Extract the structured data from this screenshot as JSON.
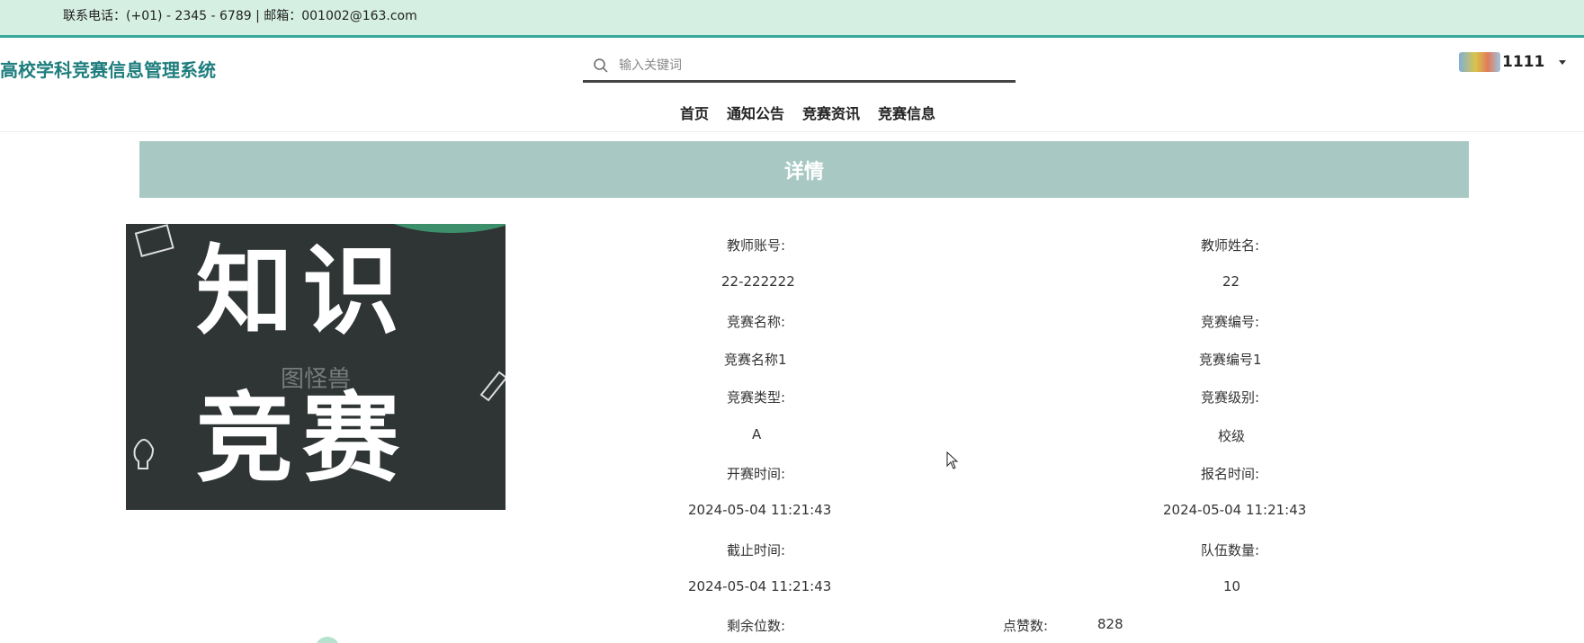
{
  "topbar": {
    "contact": "联系电话：(+01) - 2345 - 6789 | 邮箱：001002@163.com"
  },
  "header": {
    "site_title": "高校学科竞赛信息管理系统",
    "search_placeholder": "输入关键词",
    "user_name": "1111"
  },
  "nav": [
    "首页",
    "通知公告",
    "竞赛资讯",
    "竞赛信息"
  ],
  "banner": {
    "title": "详情"
  },
  "poster": {
    "line1": "知识",
    "line2": "竞赛",
    "watermark": "图怪兽"
  },
  "details": {
    "teacher_account_label": "教师账号:",
    "teacher_account": "22-222222",
    "teacher_name_label": "教师姓名:",
    "teacher_name": "22",
    "contest_name_label": "竞赛名称:",
    "contest_name": "竞赛名称1",
    "contest_no_label": "竞赛编号:",
    "contest_no": "竞赛编号1",
    "contest_type_label": "竞赛类型:",
    "contest_type": "A",
    "contest_level_label": "竞赛级别:",
    "contest_level": "校级",
    "start_time_label": "开赛时间:",
    "start_time": "2024-05-04 11:21:43",
    "signup_time_label": "报名时间:",
    "signup_time": "2024-05-04 11:21:43",
    "deadline_label": "截止时间:",
    "deadline": "2024-05-04 11:21:43",
    "team_count_label": "队伍数量:",
    "team_count": "10",
    "remaining_label": "剩余位数:",
    "likes_label": "点赞数:",
    "likes": "828"
  },
  "colors": {
    "accent": "#1f7e7e",
    "banner": "#a8c9c3",
    "topbar": "#d6efe3"
  }
}
